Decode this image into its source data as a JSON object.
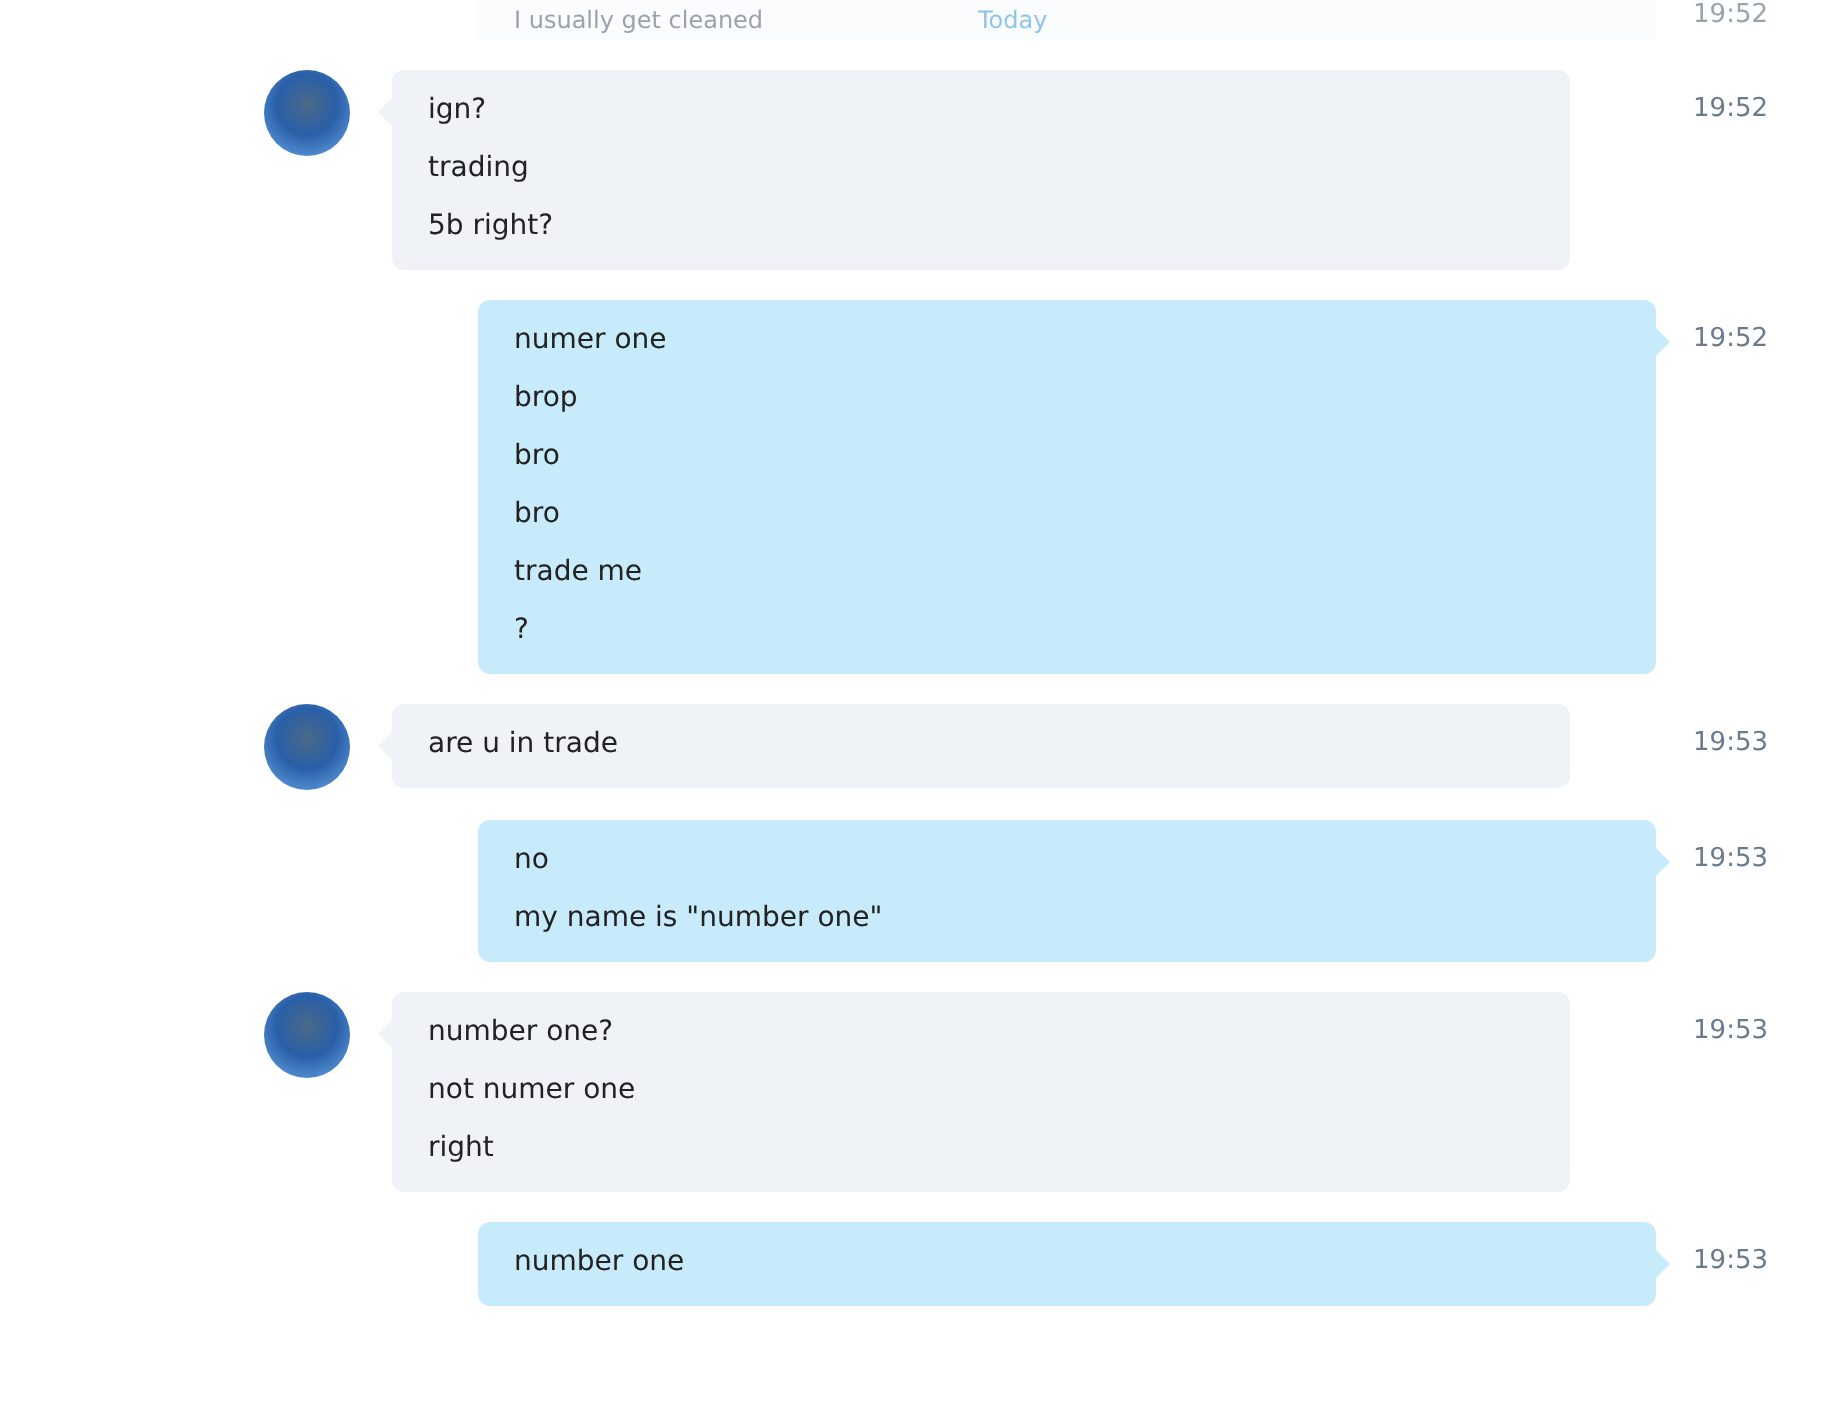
{
  "previous_message": {
    "text": "I usually get cleaned",
    "date_label": "Today",
    "time": "19:52"
  },
  "messages": [
    {
      "kind": "in",
      "lines": [
        "ign?",
        "trading",
        "5b right?"
      ],
      "time": "19:52"
    },
    {
      "kind": "out",
      "lines": [
        "numer one",
        "brop",
        "bro",
        "bro",
        "trade me",
        "?"
      ],
      "time": "19:52"
    },
    {
      "kind": "in",
      "lines": [
        "are u in trade"
      ],
      "time": "19:53"
    },
    {
      "kind": "out",
      "lines": [
        "no",
        "my name is \"number one\""
      ],
      "time": "19:53"
    },
    {
      "kind": "in",
      "lines": [
        "number one?",
        "not numer one",
        "right"
      ],
      "time": "19:53"
    },
    {
      "kind": "out",
      "lines": [
        "number one"
      ],
      "time": "19:53"
    }
  ]
}
